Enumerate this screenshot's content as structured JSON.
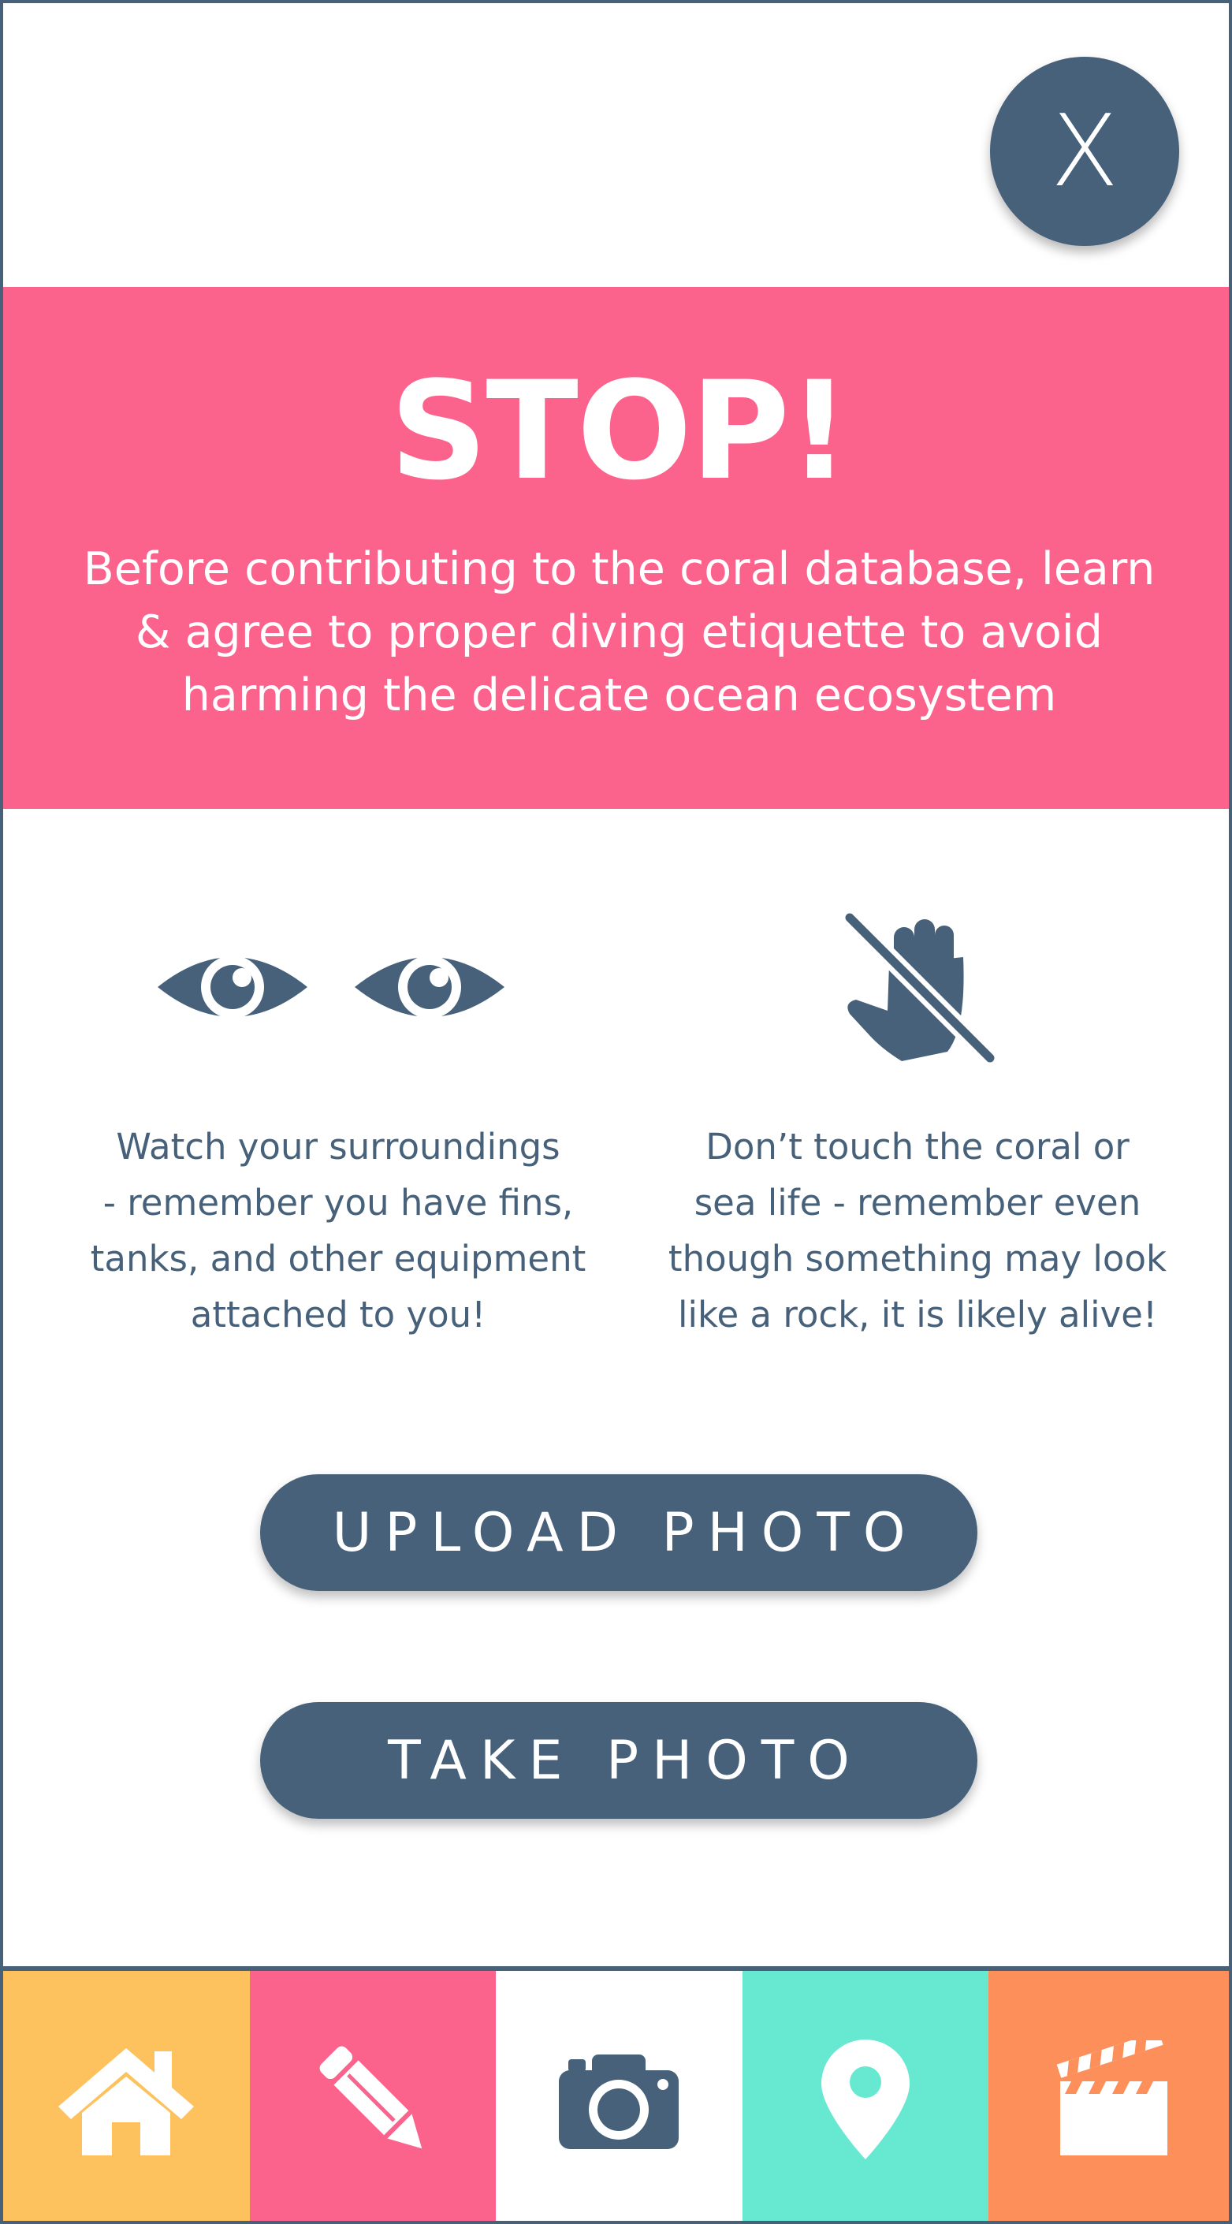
{
  "close_button": {
    "label": "X"
  },
  "banner": {
    "title": "STOP!",
    "lines": [
      "Before contributing to the coral database, learn",
      "& agree to proper diving etiquette to avoid",
      "harming the delicate ocean ecosystem"
    ],
    "background": "#fb628c"
  },
  "tips": {
    "watch": {
      "icon": "eyes-icon",
      "lines": [
        "Watch your surroundings",
        "- remember you have fins,",
        "tanks, and other equipment",
        "attached to you!"
      ]
    },
    "touch": {
      "icon": "no-touch-hand-icon",
      "lines": [
        "Don’t touch the coral or",
        "sea life - remember even",
        "though something may look",
        "like a rock, it is likely alive!"
      ]
    }
  },
  "buttons": {
    "upload": "UPLOAD PHOTO",
    "take": "TAKE PHOTO"
  },
  "nav": [
    {
      "icon": "home-icon",
      "color": "#fdc15e"
    },
    {
      "icon": "pencil-icon",
      "color": "#fb628c"
    },
    {
      "icon": "camera-icon",
      "color": "#ffffff"
    },
    {
      "icon": "map-pin-icon",
      "color": "#67e8d0"
    },
    {
      "icon": "clapperboard-icon",
      "color": "#fd8f5b"
    }
  ],
  "colors": {
    "primary": "#47617a",
    "white": "#ffffff"
  }
}
